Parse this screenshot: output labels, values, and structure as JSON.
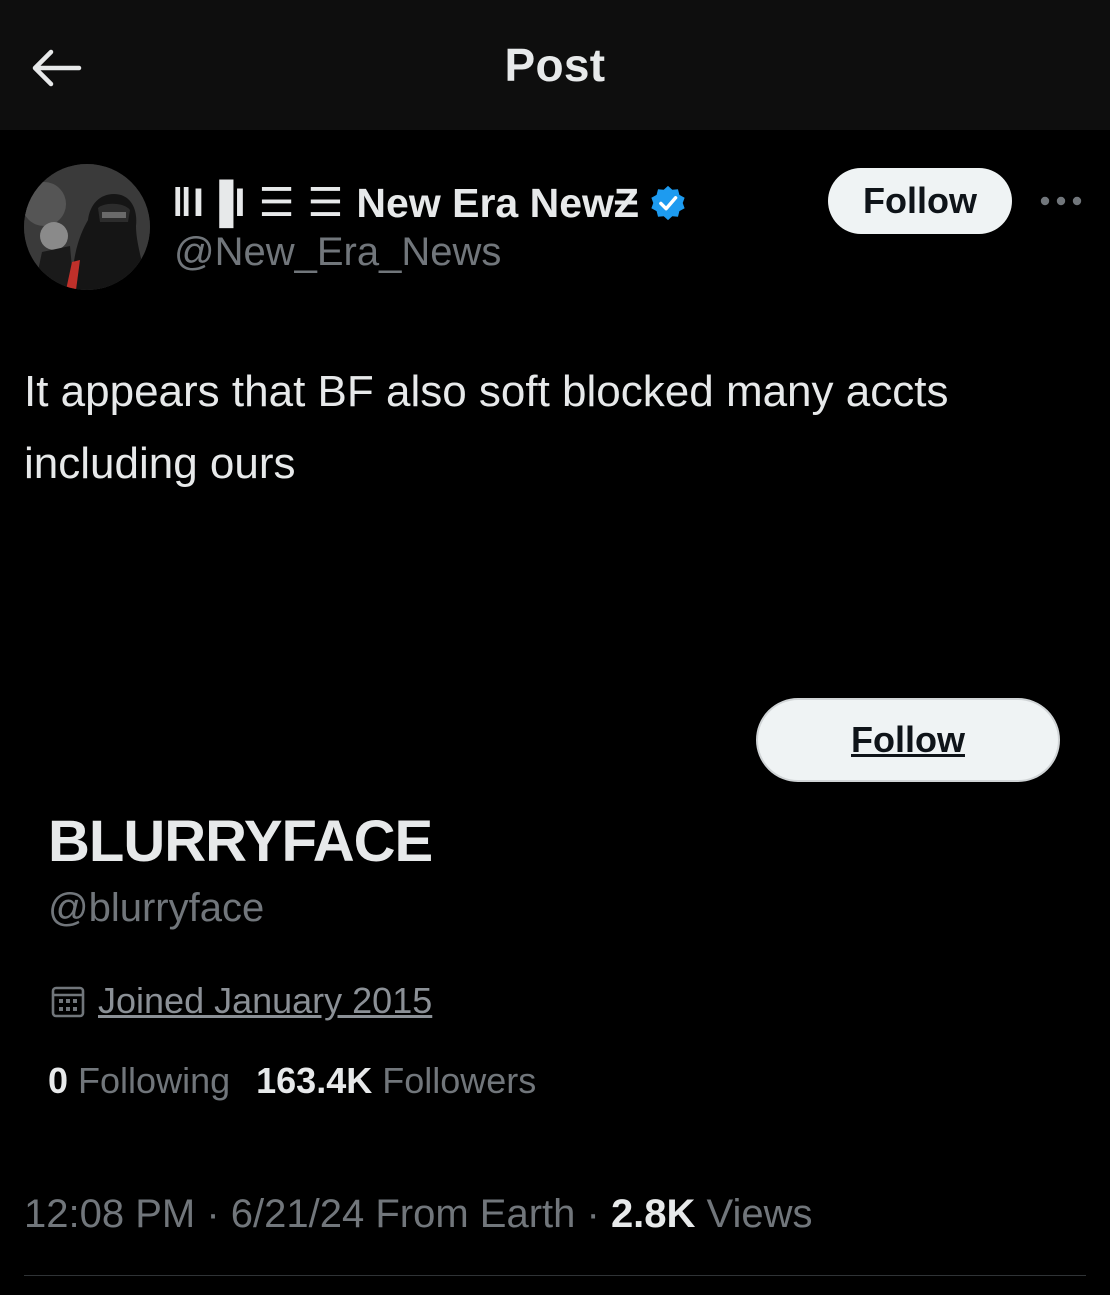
{
  "header": {
    "title": "Post",
    "back_icon": "arrow-left-icon"
  },
  "author": {
    "name_glyphs": "‖I▐I ☰ ☰",
    "display_name": "New Era NewƵ",
    "handle": "@New_Era_News",
    "verified_icon": "verified-badge-icon",
    "verified_color": "#1d9bf0",
    "follow_label": "Follow",
    "more_icon": "more-dots-icon"
  },
  "post": {
    "text": "It appears that BF also soft blocked many accts including ours"
  },
  "embedded_profile": {
    "follow_label": "Follow",
    "name": "BLURRYFACE",
    "handle": "@blurryface",
    "calendar_icon": "calendar-icon",
    "joined": "Joined January 2015",
    "following_count": "0",
    "following_label": "Following",
    "followers_count": "163.4K",
    "followers_label": "Followers"
  },
  "meta": {
    "time": "12:08 PM",
    "sep1": " · ",
    "date": "6/21/24",
    "source": " From Earth",
    "sep2": " · ",
    "views_count": "2.8K",
    "views_label": " Views"
  },
  "colors": {
    "background": "#000000",
    "header_bg": "#0e0e0e",
    "primary_text": "#e7e9ea",
    "secondary_text": "#71767b",
    "button_bg": "#eff3f4"
  }
}
